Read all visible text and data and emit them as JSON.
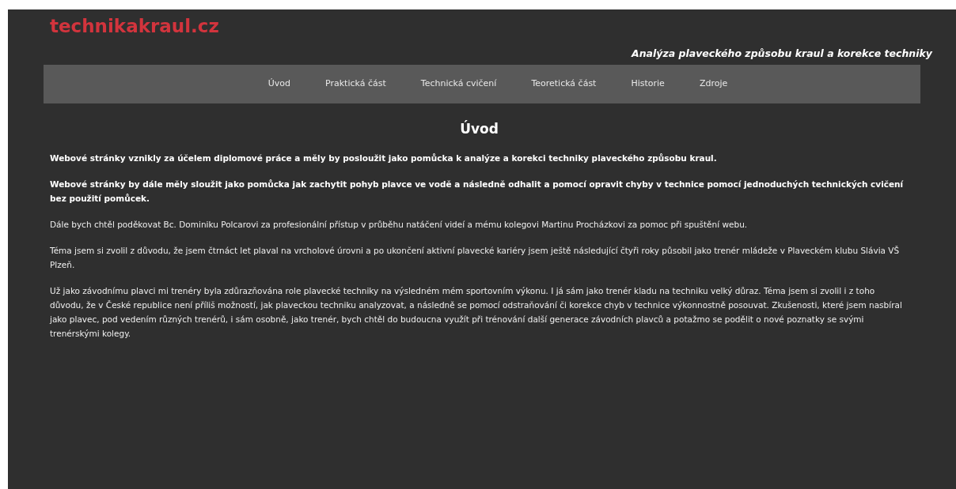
{
  "site": {
    "logo": "technikakraul.cz",
    "tagline": "Analýza plaveckého způsobu kraul a korekce techniky"
  },
  "nav": {
    "items": [
      "Úvod",
      "Praktická část",
      "Technická cvičení",
      "Teoretická část",
      "Historie",
      "Zdroje"
    ]
  },
  "content": {
    "heading": "Úvod",
    "paragraphs": [
      {
        "kind": "bold",
        "text": "Webové stránky vznikly za účelem diplomové práce a měly by posloužit jako pomůcka k analýze a korekci techniky plaveckého způsobu kraul."
      },
      {
        "kind": "bold",
        "text": "Webové stránky by dále měly sloužit jako pomůcka jak zachytit pohyb plavce ve vodě a následně odhalit a pomocí opravit chyby v technice pomocí jednoduchých technických cvičení bez použití pomůcek."
      },
      {
        "kind": "normal",
        "text": "Dále bych chtěl poděkovat Bc. Dominiku Polcarovi za profesionální přístup v průběhu natáčení videí a mému kolegovi Martinu Procházkovi za pomoc při spuštění webu."
      },
      {
        "kind": "normal",
        "text": "Téma jsem si zvolil z důvodu, že jsem čtrnáct let plaval na vrcholové úrovni a po ukončení aktivní plavecké kariéry jsem ještě následující čtyři roky působil jako trenér mládeže v Plaveckém klubu Slávia VŠ Plzeň."
      },
      {
        "kind": "normal",
        "text": "Už jako závodnímu plavci mi trenéry byla zdůrazňována role plavecké techniky na výsledném mém sportovním výkonu. I já sám jako trenér kladu na techniku velký důraz. Téma jsem si zvolil i z toho důvodu, že v České republice není příliš možností, jak plaveckou techniku analyzovat, a následně se pomocí odstraňování či korekce chyb v technice výkonnostně posouvat. Zkušenosti, které jsem nasbíral jako plavec, pod vedením různých trenérů, i sám osobně, jako trenér, bych chtěl do budoucna využít při trénování další generace závodních plavců a potažmo se podělit o nové poznatky se svými trenérskými kolegy."
      }
    ]
  }
}
